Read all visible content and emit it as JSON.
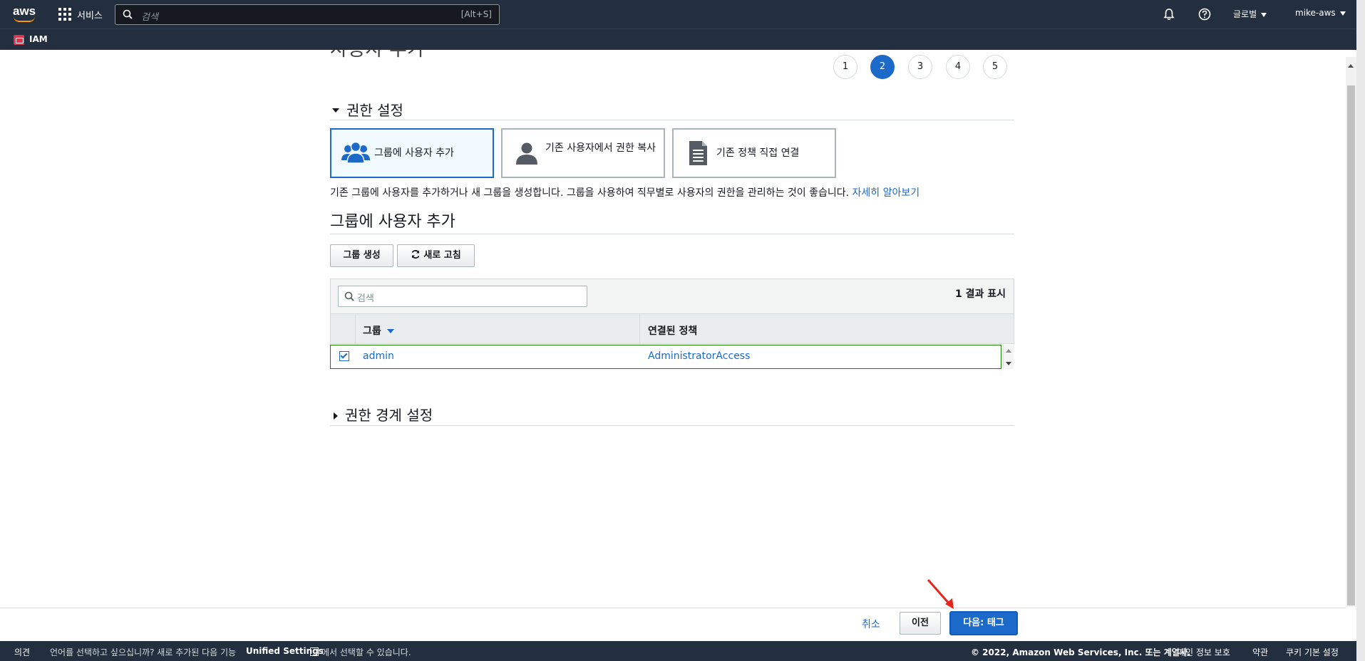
{
  "topnav": {
    "services_label": "서비스",
    "search_placeholder": "검색",
    "search_shortcut": "[Alt+S]",
    "region_label": "글로벌",
    "account_label": "mike-aws",
    "service_name": "IAM",
    "brand": "aws",
    "colors": {
      "nav_bg": "#232f3e",
      "accent": "#ff9900"
    }
  },
  "page": {
    "title": "사용자 추가",
    "steps": [
      "1",
      "2",
      "3",
      "4",
      "5"
    ],
    "active_step": "2"
  },
  "permissions": {
    "section_title": "권한 설정",
    "options": [
      {
        "label": "그룹에 사용자 추가",
        "icon": "users-group-icon",
        "selected": true
      },
      {
        "label": "기존 사용자에서 권한 복사",
        "icon": "user-icon",
        "selected": false
      },
      {
        "label": "기존 정책 직접 연결",
        "icon": "document-icon",
        "selected": false
      }
    ],
    "description": "기존 그룹에 사용자를 추가하거나 새 그룹을 생성합니다. 그룹을 사용하여 직무별로 사용자의 권한을 관리하는 것이 좋습니다.",
    "learn_more": "자세히 알아보기"
  },
  "groups": {
    "section_title": "그룹에 사용자 추가",
    "create_button": "그룹 생성",
    "refresh_button": "새로 고침",
    "search_placeholder": "검색",
    "result_count": "1 결과 표시",
    "columns": [
      "그룹",
      "연결된 정책"
    ],
    "rows": [
      {
        "group": "admin",
        "policy": "AdministratorAccess",
        "checked": true
      }
    ]
  },
  "boundary": {
    "section_title": "권한 경계 설정"
  },
  "actions": {
    "cancel": "취소",
    "previous": "이전",
    "next": "다음: 태그",
    "primary_color": "#1b6ac9"
  },
  "footer": {
    "feedback": "의견",
    "language_prompt": "언어를 선택하고 싶으십니까? 새로 추가된 다음 기능",
    "unified_settings": "Unified Settings",
    "language_suffix": "에서 선택할 수 있습니다.",
    "copyright": "© 2022, Amazon Web Services, Inc. 또는 계열사.",
    "privacy": "개인 정보 보호",
    "terms": "약관",
    "cookies": "쿠키 기본 설정"
  }
}
